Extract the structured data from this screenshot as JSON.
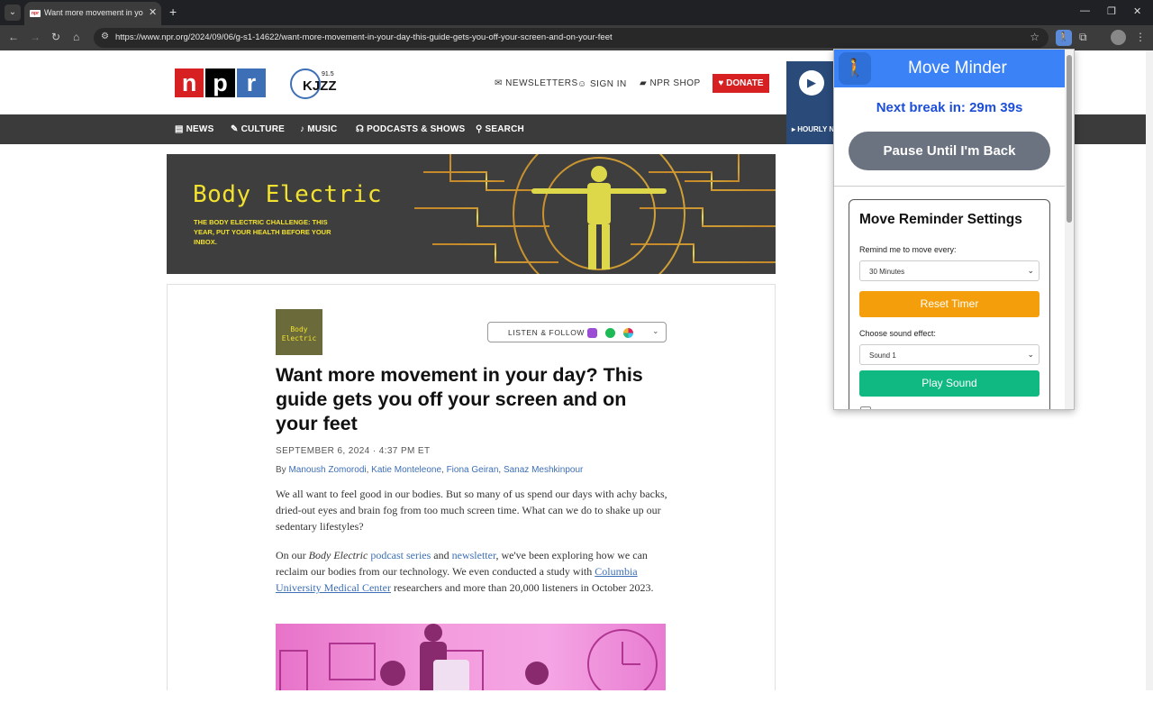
{
  "browser": {
    "tab_title": "Want more movement in your day? This guide gets you off your screen",
    "tab_close": "✕",
    "new_tab": "+",
    "url": "https://www.npr.org/2024/09/06/g-s1-14622/want-more-movement-in-your-day-this-guide-gets-you-off-your-screen-and-on-your-feet",
    "icons": [
      "tab-list-icon",
      "back-icon",
      "forward-icon",
      "reload-icon",
      "home-icon",
      "site-info-icon",
      "bookmark-star-icon",
      "move-minder-extension-icon",
      "extensions-puzzle-icon",
      "profile-icon",
      "menu-dots-icon"
    ]
  },
  "site": {
    "logo_letters": [
      "n",
      "p",
      "r"
    ],
    "logo_colors": [
      "#d62021",
      "#000000",
      "#3d6fb6"
    ],
    "station_freq": "91.5",
    "station_name": "KJZZ",
    "newsletters": "NEWSLETTERS",
    "sign_in": "SIGN IN",
    "shop": "NPR SHOP",
    "donate": "DONATE",
    "hourly": "▸ HOURLY N",
    "nav": [
      "NEWS",
      "CULTURE",
      "MUSIC",
      "PODCASTS & SHOWS",
      "SEARCH"
    ]
  },
  "banner": {
    "title": "Body Electric",
    "subtitle": "THE BODY ELECTRIC CHALLENGE: THIS YEAR, PUT YOUR HEALTH BEFORE YOUR INBOX."
  },
  "article": {
    "podcast_thumb": "Body Electric",
    "listen_follow": "LISTEN & FOLLOW",
    "headline": "Want more movement in your day? This guide gets you off your screen and on your feet",
    "dateline": "SEPTEMBER 6, 2024 · 4:37 PM ET",
    "by": "By ",
    "authors": [
      "Manoush Zomorodi",
      ", ",
      "Katie Monteleone",
      ", ",
      "Fiona Geiran",
      ", ",
      "Sanaz Meshkinpour"
    ],
    "para1": "We all want to feel good in our bodies. But so many of us spend our days with achy backs, dried-out eyes and brain fog from too much screen time. What can we do to shake up our sedentary lifestyles?",
    "para2": {
      "t1": "On our ",
      "italic": "Body Electric",
      "t2": " ",
      "link1": "podcast series",
      "t3": " and ",
      "link2": "newsletter",
      "t4": ", we've been exploring how we can reclaim our bodies from our technology. We even conducted a study with ",
      "link3": "Columbia University Medical Center",
      "t5": " researchers and more than 20,000 listeners in October 2023."
    }
  },
  "popup": {
    "title": "Move Minder",
    "next_break": "Next break in: 29m 39s",
    "pause": "Pause Until I'm Back",
    "settings_title": "Move Reminder Settings",
    "remind_label": "Remind me to move every:",
    "remind_value": "30 Minutes",
    "reset": "Reset Timer",
    "sound_label": "Choose sound effect:",
    "sound_value": "Sound 1",
    "play_sound": "Play Sound",
    "colors": {
      "header": "#3b82f6",
      "pause": "#6b7280",
      "reset": "#f59e0b",
      "play": "#10b981"
    }
  }
}
